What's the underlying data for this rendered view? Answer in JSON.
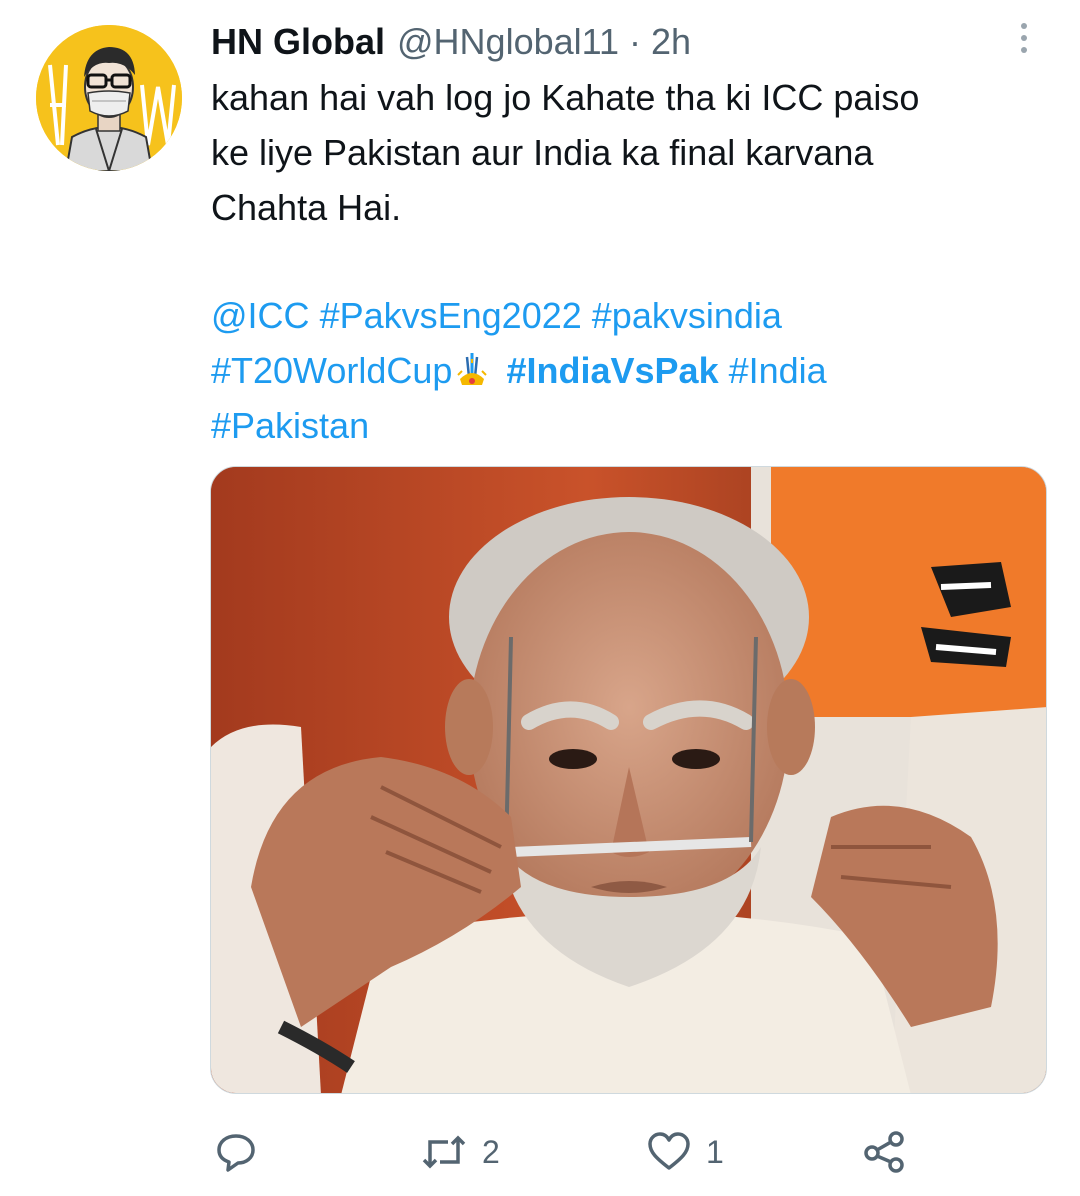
{
  "tweet": {
    "display_name": "HN Global",
    "handle": "@HNglobal11",
    "separator": "·",
    "time": "2h",
    "body_lines": [
      "kahan hai vah log jo Kahate tha ki ICC paiso",
      "ke liye Pakistan aur India ka final karvana",
      "Chahta Hai."
    ],
    "tags": {
      "mention_icc": "@ICC",
      "pakvseng": "#PakvsEng2022",
      "pakvsindia": "#pakvsindia",
      "t20worldcup": "#T20WorldCup",
      "indiavspak": "#IndiaVsPak",
      "india": "#India",
      "pakistan": "#Pakistan"
    },
    "emoji_icon": "cricket-trophy-emoji",
    "media_icon": "photo-portrait-with-glasses"
  },
  "actions": {
    "reply_icon": "reply-bubble-icon",
    "retweet_icon": "retweet-icon",
    "retweet_count": "2",
    "like_icon": "heart-icon",
    "like_count": "1",
    "share_icon": "share-icon"
  },
  "colors": {
    "link": "#1d9bf0",
    "text": "#0f1419",
    "muted": "#536471",
    "avatar_bg": "#f6c21c"
  }
}
